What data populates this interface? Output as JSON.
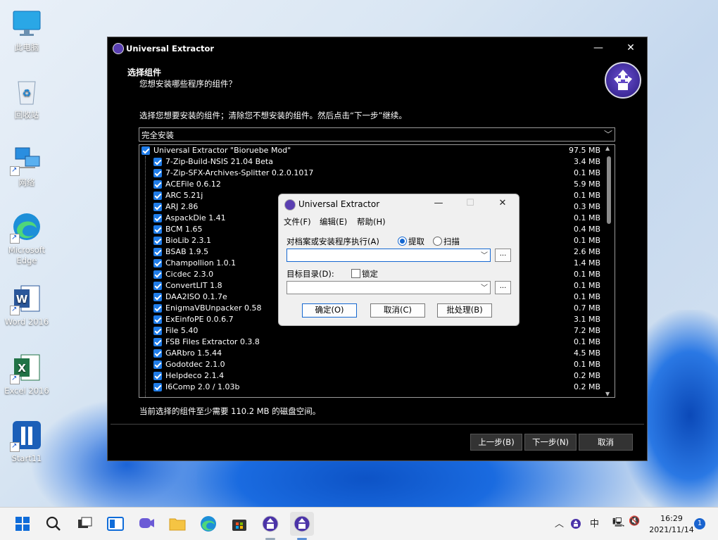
{
  "desktop": {
    "icons": [
      {
        "label": "此电脑"
      },
      {
        "label": "回收站"
      },
      {
        "label": "网络"
      },
      {
        "label": "Microsoft Edge"
      },
      {
        "label": "Word 2016"
      },
      {
        "label": "Excel 2016"
      },
      {
        "label": "Start11"
      }
    ]
  },
  "installer": {
    "title": "Universal Extractor",
    "minimize": "—",
    "close": "✕",
    "heading": "选择组件",
    "subheading": "您想安装哪些程序的组件？",
    "instruction": "选择您想要安装的组件；清除您不想安装的组件。然后点击“下一步”继续。",
    "install_type": "完全安装",
    "components": [
      {
        "name": "Universal Extractor \"Bioruebe Mod\"",
        "size": "97.5 MB",
        "checked": true
      },
      {
        "name": "7-Zip-Build-NSIS 21.04 Beta",
        "size": "3.4 MB",
        "checked": true
      },
      {
        "name": "7-Zip-SFX-Archives-Splitter 0.2.0.1017",
        "size": "0.1 MB",
        "checked": true
      },
      {
        "name": "ACEFile 0.6.12",
        "size": "5.9 MB",
        "checked": true
      },
      {
        "name": "ARC 5.21j",
        "size": "0.1 MB",
        "checked": true
      },
      {
        "name": "ARJ 2.86",
        "size": "0.3 MB",
        "checked": true
      },
      {
        "name": "AspackDie 1.41",
        "size": "0.1 MB",
        "checked": true
      },
      {
        "name": "BCM 1.65",
        "size": "0.4 MB",
        "checked": true
      },
      {
        "name": "BioLib 2.3.1",
        "size": "0.1 MB",
        "checked": true
      },
      {
        "name": "BSAB 1.9.5",
        "size": "2.6 MB",
        "checked": true
      },
      {
        "name": "Champollion 1.0.1",
        "size": "1.4 MB",
        "checked": true
      },
      {
        "name": "Cicdec 2.3.0",
        "size": "0.1 MB",
        "checked": true
      },
      {
        "name": "ConvertLIT 1.8",
        "size": "0.1 MB",
        "checked": true
      },
      {
        "name": "DAA2ISO 0.1.7e",
        "size": "0.1 MB",
        "checked": true
      },
      {
        "name": "EnigmaVBUnpacker 0.58",
        "size": "0.7 MB",
        "checked": true
      },
      {
        "name": "ExEinfoPE 0.0.6.7",
        "size": "3.1 MB",
        "checked": true
      },
      {
        "name": "File 5.40",
        "size": "7.2 MB",
        "checked": true
      },
      {
        "name": "FSB Files Extractor 0.3.8",
        "size": "0.1 MB",
        "checked": true
      },
      {
        "name": "GARbro 1.5.44",
        "size": "4.5 MB",
        "checked": true
      },
      {
        "name": "Godotdec 2.1.0",
        "size": "0.1 MB",
        "checked": true
      },
      {
        "name": "Helpdeco 2.1.4",
        "size": "0.2 MB",
        "checked": true
      },
      {
        "name": "I6Comp 2.0 / 1.03b",
        "size": "0.2 MB",
        "checked": true
      }
    ],
    "space_info": "当前选择的组件至少需要 110.2 MB 的磁盘空间。",
    "back_button": "上一步(B)",
    "next_button": "下一步(N)",
    "cancel_button": "取消"
  },
  "dialog": {
    "title": "Universal Extractor",
    "minimize": "—",
    "maximize": "☐",
    "close": "✕",
    "menu": [
      "文件(F)",
      "编辑(E)",
      "帮助(H)"
    ],
    "source_label": "对档案或安装程序执行(A)",
    "radio_extract": "提取",
    "radio_scan": "扫描",
    "target_label": "目标目录(D):",
    "lock_label": "锁定",
    "browse": "...",
    "ok_button": "确定(O)",
    "cancel_button": "取消(C)",
    "batch_button": "批处理(B)"
  },
  "taskbar": {
    "tray_ime": "中",
    "time": "16:29",
    "date": "2021/11/14",
    "notification_count": "1"
  }
}
